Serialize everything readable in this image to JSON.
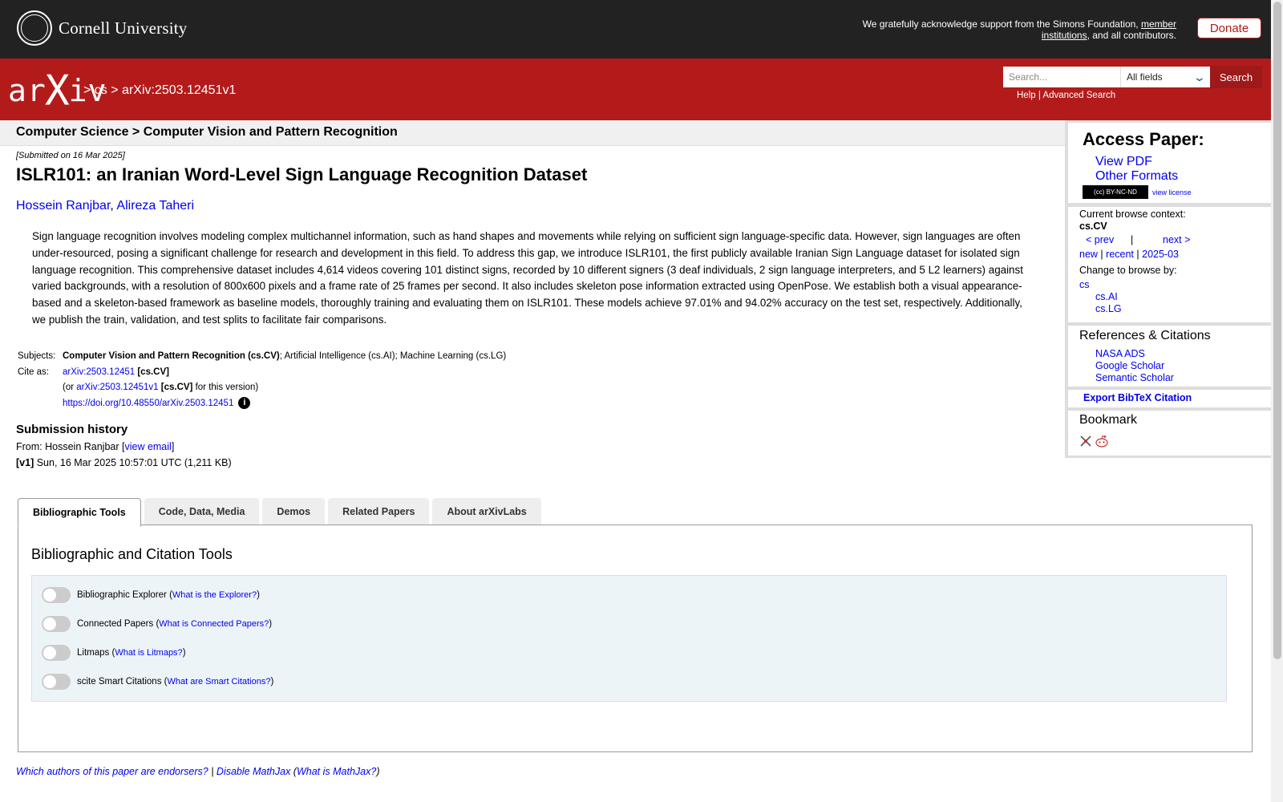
{
  "header": {
    "cornell_name": "Cornell University",
    "support_text": "We gratefully acknowledge support from the Simons Foundation,",
    "support_link": "member institutions",
    "support_tail": ", and all contributors.",
    "donate_label": "Donate"
  },
  "nav": {
    "logo_ar": "ar",
    "logo_x": "X",
    "logo_iv": "iv",
    "crumb1": "> cs",
    "crumb2": "> arXiv:2503.12451v1",
    "search_placeholder": "Search...",
    "select_value": "All fields",
    "search_button": "Search",
    "help": "Help",
    "sep": "|",
    "advanced": "Advanced Search"
  },
  "category": "Computer Science > Computer Vision and Pattern Recognition",
  "paper": {
    "submitted": "[Submitted on 16 Mar 2025]",
    "title": "ISLR101: an Iranian Word-Level Sign Language Recognition Dataset",
    "author1": "Hossein Ranjbar",
    "author_sep": ", ",
    "author2": "Alireza Taheri",
    "abstract": "Sign language recognition involves modeling complex multichannel information, such as hand shapes and movements while relying on sufficient sign language-specific data. However, sign languages are often under-resourced, posing a significant challenge for research and development in this field. To address this gap, we introduce ISLR101, the first publicly available Iranian Sign Language dataset for isolated sign language recognition. This comprehensive dataset includes 4,614 videos covering 101 distinct signs, recorded by 10 different signers (3 deaf individuals, 2 sign language interpreters, and 5 L2 learners) against varied backgrounds, with a resolution of 800x600 pixels and a frame rate of 25 frames per second. It also includes skeleton pose information extracted using OpenPose. We establish both a visual appearance-based and a skeleton-based framework as baseline models, thoroughly training and evaluating them on ISLR101. These models achieve 97.01% and 94.02% accuracy on the test set, respectively. Additionally, we publish the train, validation, and test splits to facilitate fair comparisons."
  },
  "meta": {
    "subjects_label": "Subjects:",
    "subjects_primary": "Computer Vision and Pattern Recognition (cs.CV)",
    "subjects_rest": "; Artificial Intelligence (cs.AI); Machine Learning (cs.LG)",
    "cite_label": "Cite as:",
    "cite_link": "arXiv:2503.12451",
    "cite_cat": " [cs.CV]",
    "or_open": "(or ",
    "version_link": "arXiv:2503.12451v1",
    "version_cat": " [cs.CV]",
    "version_tail": " for this version)",
    "doi": "https://doi.org/10.48550/arXiv.2503.12451",
    "info_icon": "i"
  },
  "history": {
    "heading": "Submission history",
    "from_text": "From: Hossein Ranjbar [",
    "view_email": "view email",
    "from_close": "]",
    "v1_label": "[v1]",
    "v1_text": " Sun, 16 Mar 2025 10:57:01 UTC (1,211 KB)"
  },
  "sidebar": {
    "access_heading": "Access Paper:",
    "view_pdf": "View PDF",
    "other_formats": "Other Formats",
    "cc_badge": "(cc) BY-NC-ND",
    "view_license": "view license",
    "browse_context": "Current browse context:",
    "context": "cs.CV",
    "prev": "< prev",
    "pipe": "|",
    "next": "next >",
    "new": "new",
    "recent": "recent",
    "date": "2025-03",
    "change_browse": "Change to browse by:",
    "cs": "cs",
    "cs_ai": "cs.AI",
    "cs_lg": "cs.LG",
    "refs_heading": "References & Citations",
    "nasa": "NASA ADS",
    "google": "Google Scholar",
    "semantic": "Semantic Scholar",
    "export": "Export BibTeX Citation",
    "bookmark": "Bookmark"
  },
  "tabs": [
    "Bibliographic Tools",
    "Code, Data, Media",
    "Demos",
    "Related Papers",
    "About arXivLabs"
  ],
  "tools": {
    "heading": "Bibliographic and Citation Tools",
    "items": [
      {
        "name": "Bibliographic Explorer",
        "link": "What is the Explorer?"
      },
      {
        "name": "Connected Papers",
        "link": "What is Connected Papers?"
      },
      {
        "name": "Litmaps",
        "link": "What is Litmaps?"
      },
      {
        "name": "scite Smart Citations",
        "link": "What are Smart Citations?"
      }
    ]
  },
  "footer": {
    "endorsers": "Which authors of this paper are endorsers?",
    "sep": " | ",
    "disable": "Disable MathJax",
    "what": "What is MathJax?"
  },
  "colors": {
    "brand_red": "#b31b1b",
    "top_bar": "#222222",
    "link_blue": "#0000ee"
  }
}
